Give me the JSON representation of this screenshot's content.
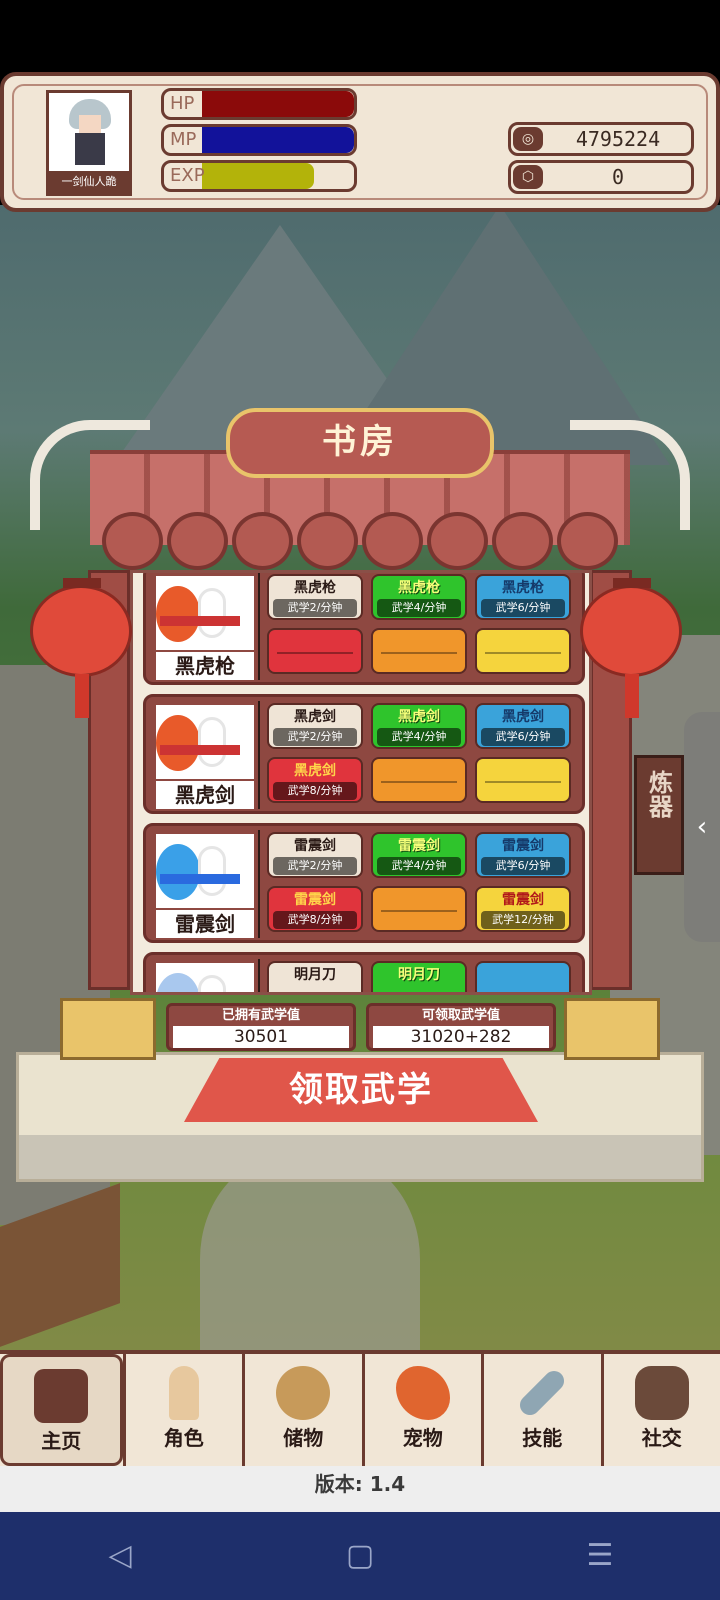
{
  "player": {
    "name": "一剑仙人跪",
    "bars": [
      {
        "label": "HP",
        "fill": 1.0,
        "color": "#8b0a0a"
      },
      {
        "label": "MP",
        "fill": 1.0,
        "color": "#12129a"
      },
      {
        "label": "EXP",
        "fill": 0.74,
        "color": "#b3b30a"
      }
    ]
  },
  "currency": {
    "coins": "4795224",
    "gems": "0",
    "coin_icon": "coin-icon",
    "gem_icon": "gem-icon"
  },
  "building": {
    "title": "书房"
  },
  "skills": [
    {
      "name": "黑虎枪",
      "tiers": [
        {
          "name": "黑虎枪",
          "rate": "武学2/分钟",
          "style": "t-white"
        },
        {
          "name": "黑虎枪",
          "rate": "武学4/分钟",
          "style": "t-green"
        },
        {
          "name": "黑虎枪",
          "rate": "武学6/分钟",
          "style": "t-blue"
        },
        {
          "name": "",
          "rate": "",
          "style": "t-red empty"
        },
        {
          "name": "",
          "rate": "",
          "style": "t-orange empty"
        },
        {
          "name": "",
          "rate": "",
          "style": "t-yellow empty"
        }
      ]
    },
    {
      "name": "黑虎剑",
      "tiers": [
        {
          "name": "黑虎剑",
          "rate": "武学2/分钟",
          "style": "t-white"
        },
        {
          "name": "黑虎剑",
          "rate": "武学4/分钟",
          "style": "t-green"
        },
        {
          "name": "黑虎剑",
          "rate": "武学6/分钟",
          "style": "t-blue"
        },
        {
          "name": "黑虎剑",
          "rate": "武学8/分钟",
          "style": "t-red"
        },
        {
          "name": "",
          "rate": "",
          "style": "t-orange empty"
        },
        {
          "name": "",
          "rate": "",
          "style": "t-yellow empty"
        }
      ]
    },
    {
      "name": "雷震剑",
      "tiers": [
        {
          "name": "雷震剑",
          "rate": "武学2/分钟",
          "style": "t-white"
        },
        {
          "name": "雷震剑",
          "rate": "武学4/分钟",
          "style": "t-green"
        },
        {
          "name": "雷震剑",
          "rate": "武学6/分钟",
          "style": "t-blue"
        },
        {
          "name": "雷震剑",
          "rate": "武学8/分钟",
          "style": "t-red"
        },
        {
          "name": "",
          "rate": "",
          "style": "t-orange empty"
        },
        {
          "name": "雷震剑",
          "rate": "武学12/分钟",
          "style": "t-yellow"
        }
      ]
    },
    {
      "name": "",
      "tiers": [
        {
          "name": "明月刀",
          "rate": "",
          "style": "t-white"
        },
        {
          "name": "明月刀",
          "rate": "",
          "style": "t-green"
        },
        {
          "name": "",
          "rate": "",
          "style": "t-blue"
        }
      ]
    }
  ],
  "counters": {
    "owned_label": "已拥有武学值",
    "owned_value": "30501",
    "claim_label": "可领取武学值",
    "claim_value": "31020+282"
  },
  "claim_button": "领取武学",
  "side_tab": "炼器",
  "side_arrow": "‹",
  "nav": [
    {
      "label": "主页",
      "icon": "home",
      "active": true
    },
    {
      "label": "角色",
      "icon": "role",
      "active": false
    },
    {
      "label": "储物",
      "icon": "bag",
      "active": false
    },
    {
      "label": "宠物",
      "icon": "pet",
      "active": false
    },
    {
      "label": "技能",
      "icon": "skill",
      "active": false
    },
    {
      "label": "社交",
      "icon": "social",
      "active": false
    }
  ],
  "version": "版本: 1.4",
  "system_nav": [
    "◁",
    "▢",
    "☰"
  ]
}
